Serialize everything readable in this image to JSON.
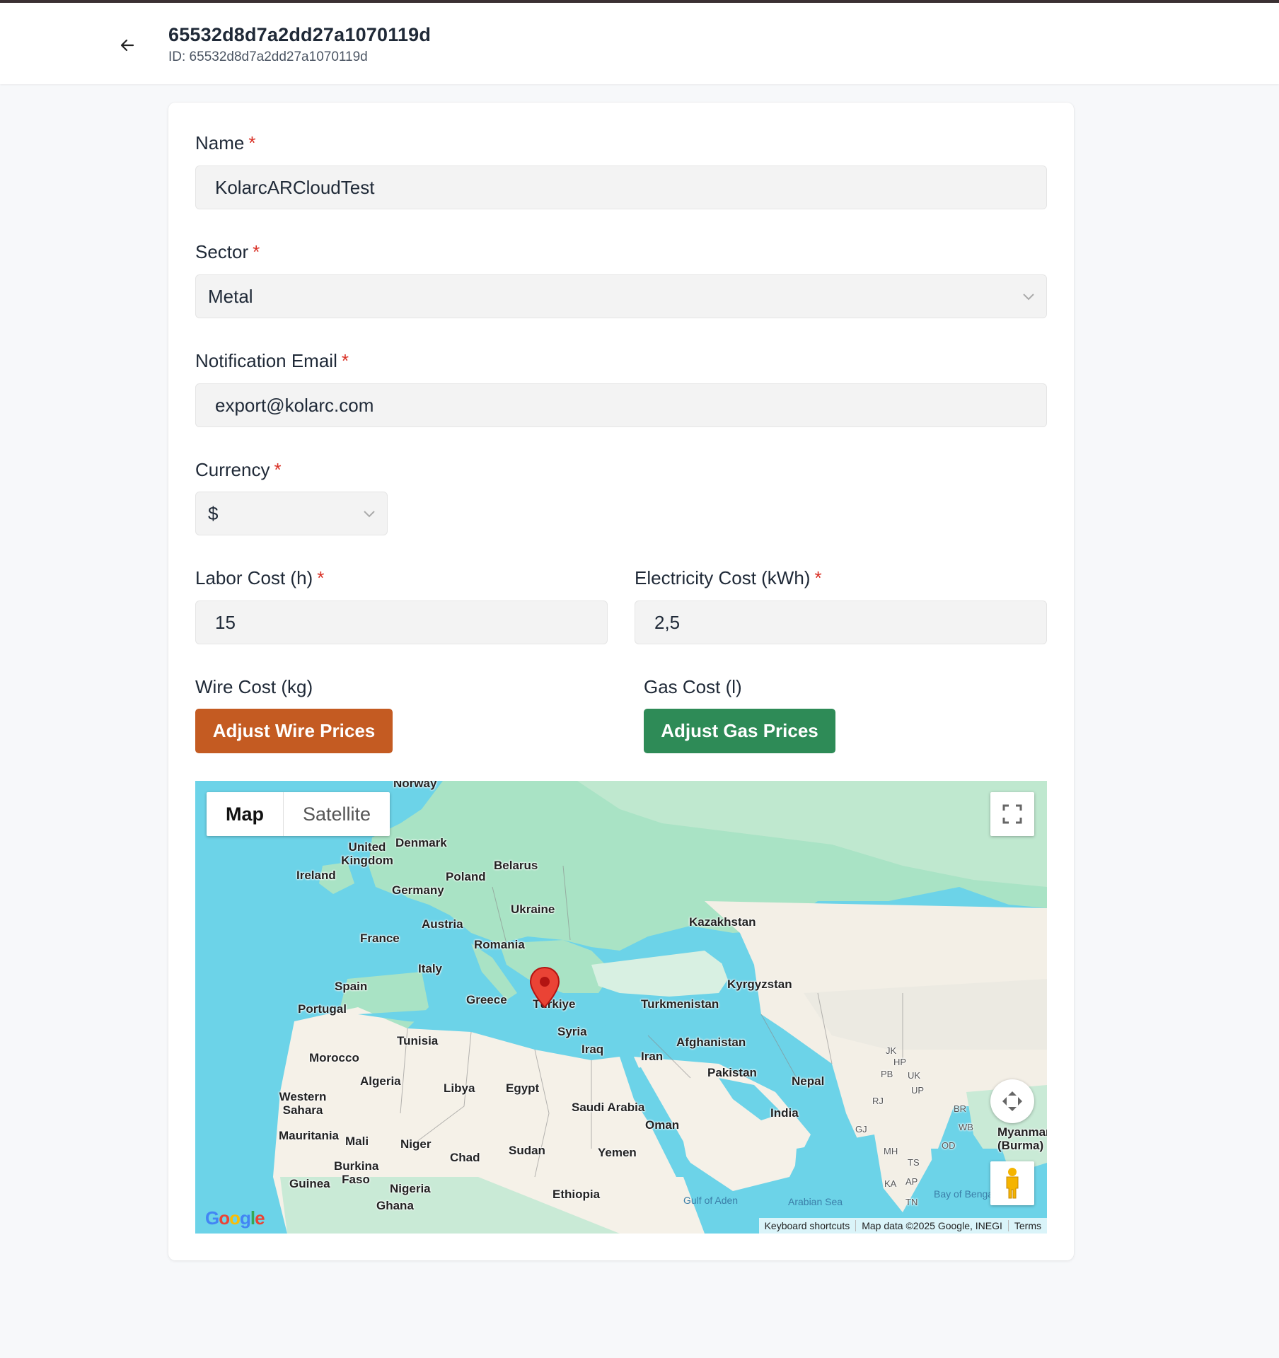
{
  "header": {
    "title": "65532d8d7a2dd27a1070119d",
    "subtitle": "ID: 65532d8d7a2dd27a1070119d"
  },
  "form": {
    "name": {
      "label": "Name",
      "required": "*",
      "value": "KolarcARCloudTest"
    },
    "sector": {
      "label": "Sector",
      "required": "*",
      "value": "Metal"
    },
    "email": {
      "label": "Notification Email",
      "required": "*",
      "value": "export@kolarc.com"
    },
    "currency": {
      "label": "Currency",
      "required": "*",
      "value": "$"
    },
    "labor": {
      "label": "Labor Cost (h)",
      "required": "*",
      "value": "15"
    },
    "electricity": {
      "label": "Electricity Cost (kWh)",
      "required": "*",
      "value": "2,5"
    },
    "wire": {
      "label": "Wire Cost (kg)",
      "button": "Adjust Wire Prices"
    },
    "gas": {
      "label": "Gas Cost (l)",
      "button": "Adjust Gas Prices"
    }
  },
  "colors": {
    "wire_button": "#c45b22",
    "gas_button": "#2e8b57",
    "required_mark": "#d93025"
  },
  "map": {
    "type_map": "Map",
    "type_satellite": "Satellite",
    "footer": {
      "shortcuts": "Keyboard shortcuts",
      "data": "Map data ©2025 Google, INEGI",
      "terms": "Terms"
    },
    "logo": "Google",
    "countries": [
      "Norway",
      "Denmark",
      "United Kingdom",
      "Ireland",
      "Poland",
      "Belarus",
      "Germany",
      "Ukraine",
      "Austria",
      "France",
      "Romania",
      "Italy",
      "Spain",
      "Portugal",
      "Greece",
      "Türkiye",
      "Kazakhstan",
      "Kyrgyzstan",
      "Turkmenistan",
      "Syria",
      "Iraq",
      "Iran",
      "Afghanistan",
      "Tunisia",
      "Morocco",
      "Algeria",
      "Libya",
      "Egypt",
      "Pakistan",
      "Nepal",
      "India",
      "Western Sahara",
      "Saudi Arabia",
      "Oman",
      "Mauritania",
      "Mali",
      "Niger",
      "Chad",
      "Sudan",
      "Yemen",
      "Burkina Faso",
      "Guinea",
      "Nigeria",
      "Ghana",
      "Ethiopia",
      "Myanmar (Burma)"
    ],
    "regions": [
      "JK",
      "HP",
      "PB",
      "UK",
      "UP",
      "RJ",
      "GJ",
      "MH",
      "TS",
      "KA",
      "AP",
      "TN",
      "OD",
      "BR",
      "WB"
    ],
    "seas": [
      "Gulf of Aden",
      "Arabian Sea",
      "Bay of Bengal"
    ],
    "marker_icon": "map-pin-icon",
    "icons": [
      "fullscreen-icon",
      "camera-control-icon",
      "pegman-icon",
      "back-arrow-icon",
      "chevron-down-icon"
    ]
  }
}
